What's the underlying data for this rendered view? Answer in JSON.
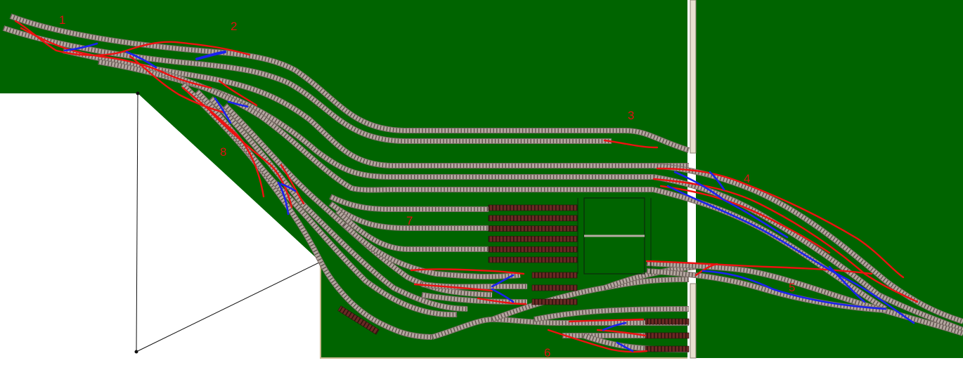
{
  "colors": {
    "baseboard": "#006400",
    "background": "#ffffff",
    "track_rail": "#b4a8a0",
    "track_tie": "#6a5a55",
    "siding": "#5a2a22",
    "red_route": "#ee1111",
    "blue_route": "#1a22ee",
    "label": "#e01010",
    "turntable_line": "#0c2a0c",
    "wall": "#e8e0d0"
  },
  "labels": [
    "1",
    "2",
    "3",
    "4",
    "5",
    "6",
    "7",
    "8"
  ]
}
